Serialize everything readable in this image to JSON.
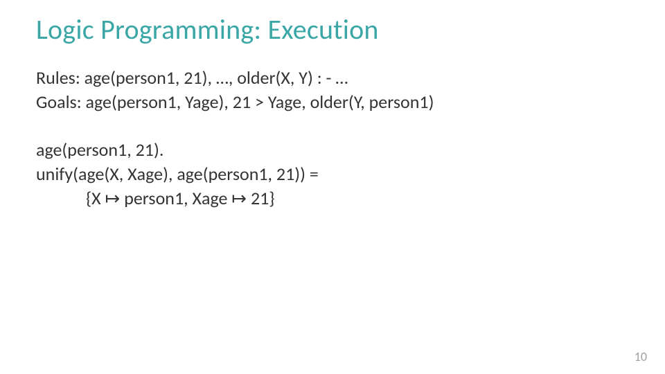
{
  "title": "Logic Programming: Execution",
  "rules_line": "Rules: age(person1, 21), …, older(X, Y) : - …",
  "goals_line": "Goals: age(person1, Yage), 21 > Yage, older(Y, person1)",
  "fact_line": "age(person1, 21).",
  "unify_line": "unify(age(X, Xage), age(person1, 21)) =",
  "subst_line": "{X ↦ person1, Xage ↦ 21}",
  "page_number": "10"
}
